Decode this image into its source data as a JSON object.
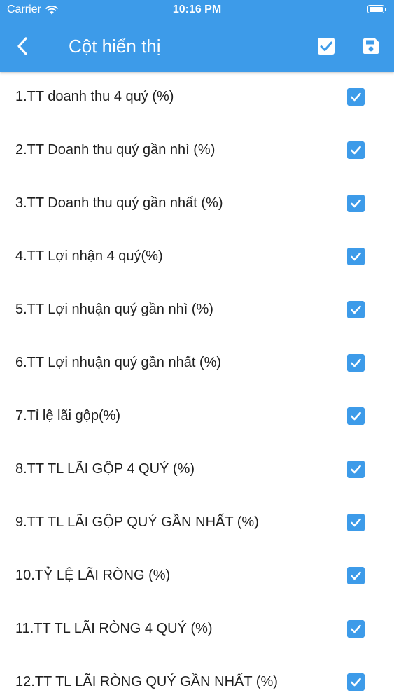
{
  "status_bar": {
    "carrier": "Carrier",
    "time": "10:16 PM"
  },
  "header": {
    "title": "Cột hiển thị",
    "background_color": "#3d9be9"
  },
  "icons": {
    "back": "chevron-left-icon",
    "select_all": "checkbox-checked-icon",
    "save": "floppy-disk-icon"
  },
  "columns": [
    {
      "label": "1.TT doanh thu 4 quý (%)",
      "checked": true
    },
    {
      "label": "2.TT Doanh thu quý gần nhì (%)",
      "checked": true
    },
    {
      "label": "3.TT Doanh thu quý gần nhất (%)",
      "checked": true
    },
    {
      "label": "4.TT Lợi nhận 4 quý(%)",
      "checked": true
    },
    {
      "label": "5.TT Lợi nhuận quý gần nhì (%)",
      "checked": true
    },
    {
      "label": "6.TT Lợi nhuận quý gần nhất (%)",
      "checked": true
    },
    {
      "label": "7.Tỉ lệ lãi gộp(%)",
      "checked": true
    },
    {
      "label": "8.TT TL LÃI GỘP 4 QUÝ (%)",
      "checked": true
    },
    {
      "label": "9.TT TL LÃI GỘP QUÝ GẦN NHẤT (%)",
      "checked": true
    },
    {
      "label": "10.TỶ LỆ LÃI RÒNG (%)",
      "checked": true
    },
    {
      "label": "11.TT TL LÃI RÒNG 4 QUÝ (%)",
      "checked": true
    },
    {
      "label": "12.TT TL LÃI RÒNG QUÝ GẦN NHẤT (%)",
      "checked": true
    }
  ]
}
